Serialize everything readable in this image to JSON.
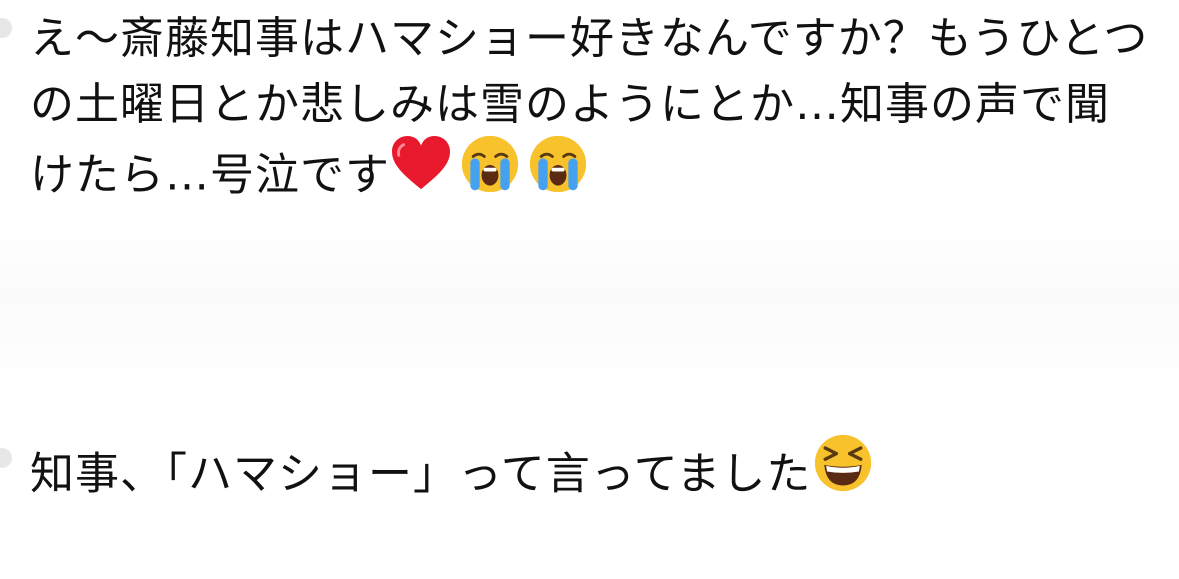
{
  "comments": [
    {
      "text": "え〜斎藤知事はハマショー好きなんですか？もうひとつの土曜日とか悲しみは雪のようにとか…知事の声で聞けたら…号泣です",
      "emojis": [
        "red-heart-icon",
        "loudly-crying-face-icon",
        "loudly-crying-face-icon"
      ]
    },
    {
      "text": "知事、「ハマショー」って言ってました",
      "emojis": [
        "grinning-squinting-face-icon"
      ]
    }
  ],
  "colors": {
    "text": "#111111",
    "background": "#ffffff",
    "heart": "#e8192c",
    "emoji_face": "#f8c22c",
    "tears": "#46a2f0"
  }
}
